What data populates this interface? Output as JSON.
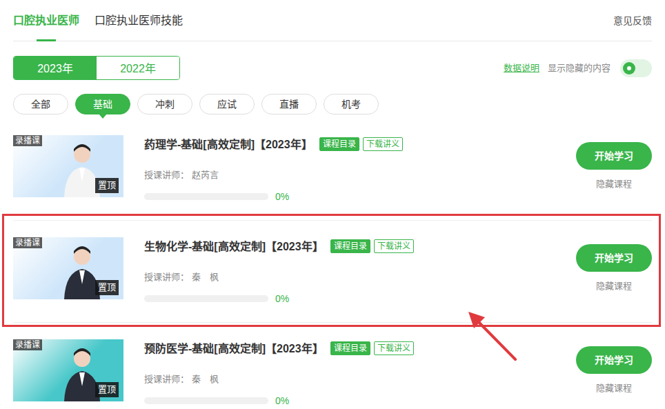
{
  "header": {
    "tabs": [
      {
        "label": "口腔执业医师",
        "selected": true
      },
      {
        "label": "口腔执业医师技能",
        "selected": false
      }
    ],
    "feedback": "意见反馈"
  },
  "years": [
    {
      "label": "2023年",
      "selected": true
    },
    {
      "label": "2022年",
      "selected": false
    }
  ],
  "data_link": "数据说明",
  "show_hidden": {
    "label": "显示隐藏的内容",
    "on": false
  },
  "filters": [
    {
      "label": "全部",
      "selected": false
    },
    {
      "label": "基础",
      "selected": true
    },
    {
      "label": "冲刺",
      "selected": false
    },
    {
      "label": "应试",
      "selected": false
    },
    {
      "label": "直播",
      "selected": false
    },
    {
      "label": "机考",
      "selected": false
    }
  ],
  "courses": [
    {
      "badge": "录播课",
      "pin": "置顶",
      "color": "#cfe6fa",
      "title": "药理学-基础[高效定制]【2023年】",
      "catalog": "课程目录",
      "handout": "下载讲义",
      "teacher_label": "授课讲师：",
      "teacher": "赵芮言",
      "level": 0,
      "progress": "0%",
      "start": "开始学习",
      "hide": "隐藏课程",
      "highlighted": false
    },
    {
      "badge": "录播课",
      "pin": "置顶",
      "color": "#cfe6fa",
      "title": "生物化学-基础[高效定制]【2023年】",
      "catalog": "课程目录",
      "handout": "下载讲义",
      "teacher_label": "授课讲师：",
      "teacher": "秦　枫",
      "level": 0,
      "progress": "0%",
      "start": "开始学习",
      "hide": "隐藏课程",
      "highlighted": true
    },
    {
      "badge": "录播课",
      "pin": "置顶",
      "color": "#47c7c9",
      "title": "预防医学-基础[高效定制]【2023年】",
      "catalog": "课程目录",
      "handout": "下载讲义",
      "teacher_label": "授课讲师：",
      "teacher": "秦　枫",
      "level": 0,
      "progress": "0%",
      "start": "开始学习",
      "hide": "隐藏课程",
      "highlighted": false
    }
  ]
}
